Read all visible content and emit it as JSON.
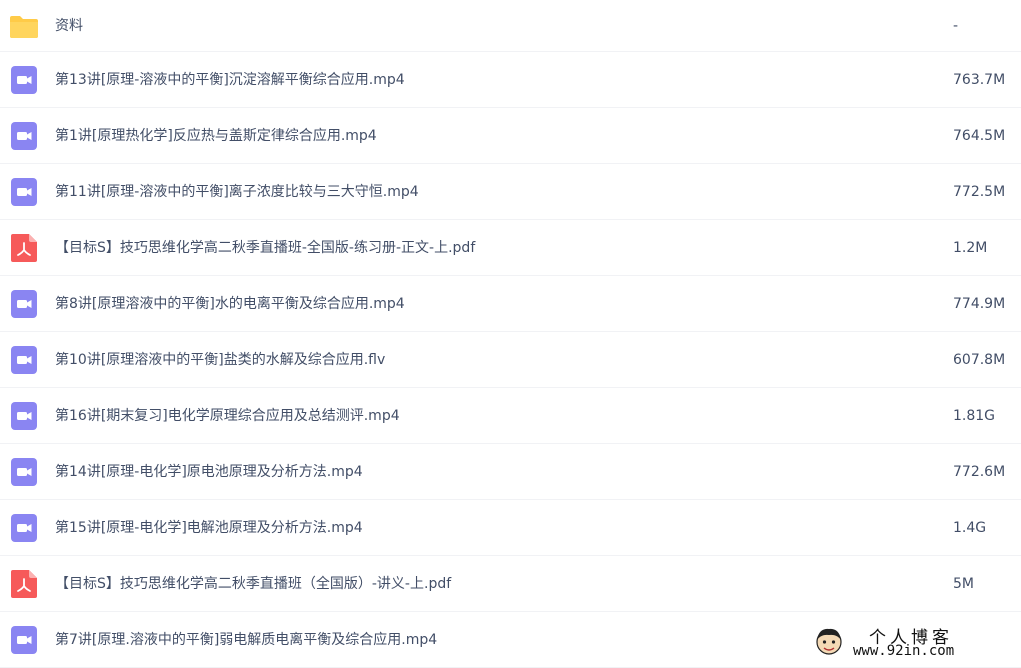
{
  "colors": {
    "folder": "#ffcb48",
    "video": "#8a85f2",
    "pdf": "#f65a5a",
    "text": "#424e67",
    "divider": "#f1f2f5"
  },
  "files": [
    {
      "type": "folder",
      "icon": "folder-icon",
      "name": "资料",
      "size": "-"
    },
    {
      "type": "video",
      "icon": "video-icon",
      "name": "第13讲[原理-溶液中的平衡]沉淀溶解平衡综合应用.mp4",
      "size": "763.7M"
    },
    {
      "type": "video",
      "icon": "video-icon",
      "name": "第1讲[原理热化学]反应热与盖斯定律综合应用.mp4",
      "size": "764.5M"
    },
    {
      "type": "video",
      "icon": "video-icon",
      "name": "第11讲[原理-溶液中的平衡]离子浓度比较与三大守恒.mp4",
      "size": "772.5M"
    },
    {
      "type": "pdf",
      "icon": "pdf-icon",
      "name": "【目标S】技巧思维化学高二秋季直播班-全国版-练习册-正文-上.pdf",
      "size": "1.2M"
    },
    {
      "type": "video",
      "icon": "video-icon",
      "name": "第8讲[原理溶液中的平衡]水的电离平衡及综合应用.mp4",
      "size": "774.9M"
    },
    {
      "type": "video",
      "icon": "video-icon",
      "name": "第10讲[原理溶液中的平衡]盐类的水解及综合应用.flv",
      "size": "607.8M"
    },
    {
      "type": "video",
      "icon": "video-icon",
      "name": "第16讲[期末复习]电化学原理综合应用及总结测评.mp4",
      "size": "1.81G"
    },
    {
      "type": "video",
      "icon": "video-icon",
      "name": "第14讲[原理-电化学]原电池原理及分析方法.mp4",
      "size": "772.6M"
    },
    {
      "type": "video",
      "icon": "video-icon",
      "name": "第15讲[原理-电化学]电解池原理及分析方法.mp4",
      "size": "1.4G"
    },
    {
      "type": "pdf",
      "icon": "pdf-icon",
      "name": "【目标S】技巧思维化学高二秋季直播班（全国版）-讲义-上.pdf",
      "size": "5M"
    },
    {
      "type": "video",
      "icon": "video-icon",
      "name": "第7讲[原理.溶液中的平衡]弱电解质电离平衡及综合应用.mp4",
      "size": ""
    }
  ],
  "watermark": {
    "title": "个人博客",
    "url": "www.92in.com",
    "icon": "cartoon-face-icon"
  }
}
